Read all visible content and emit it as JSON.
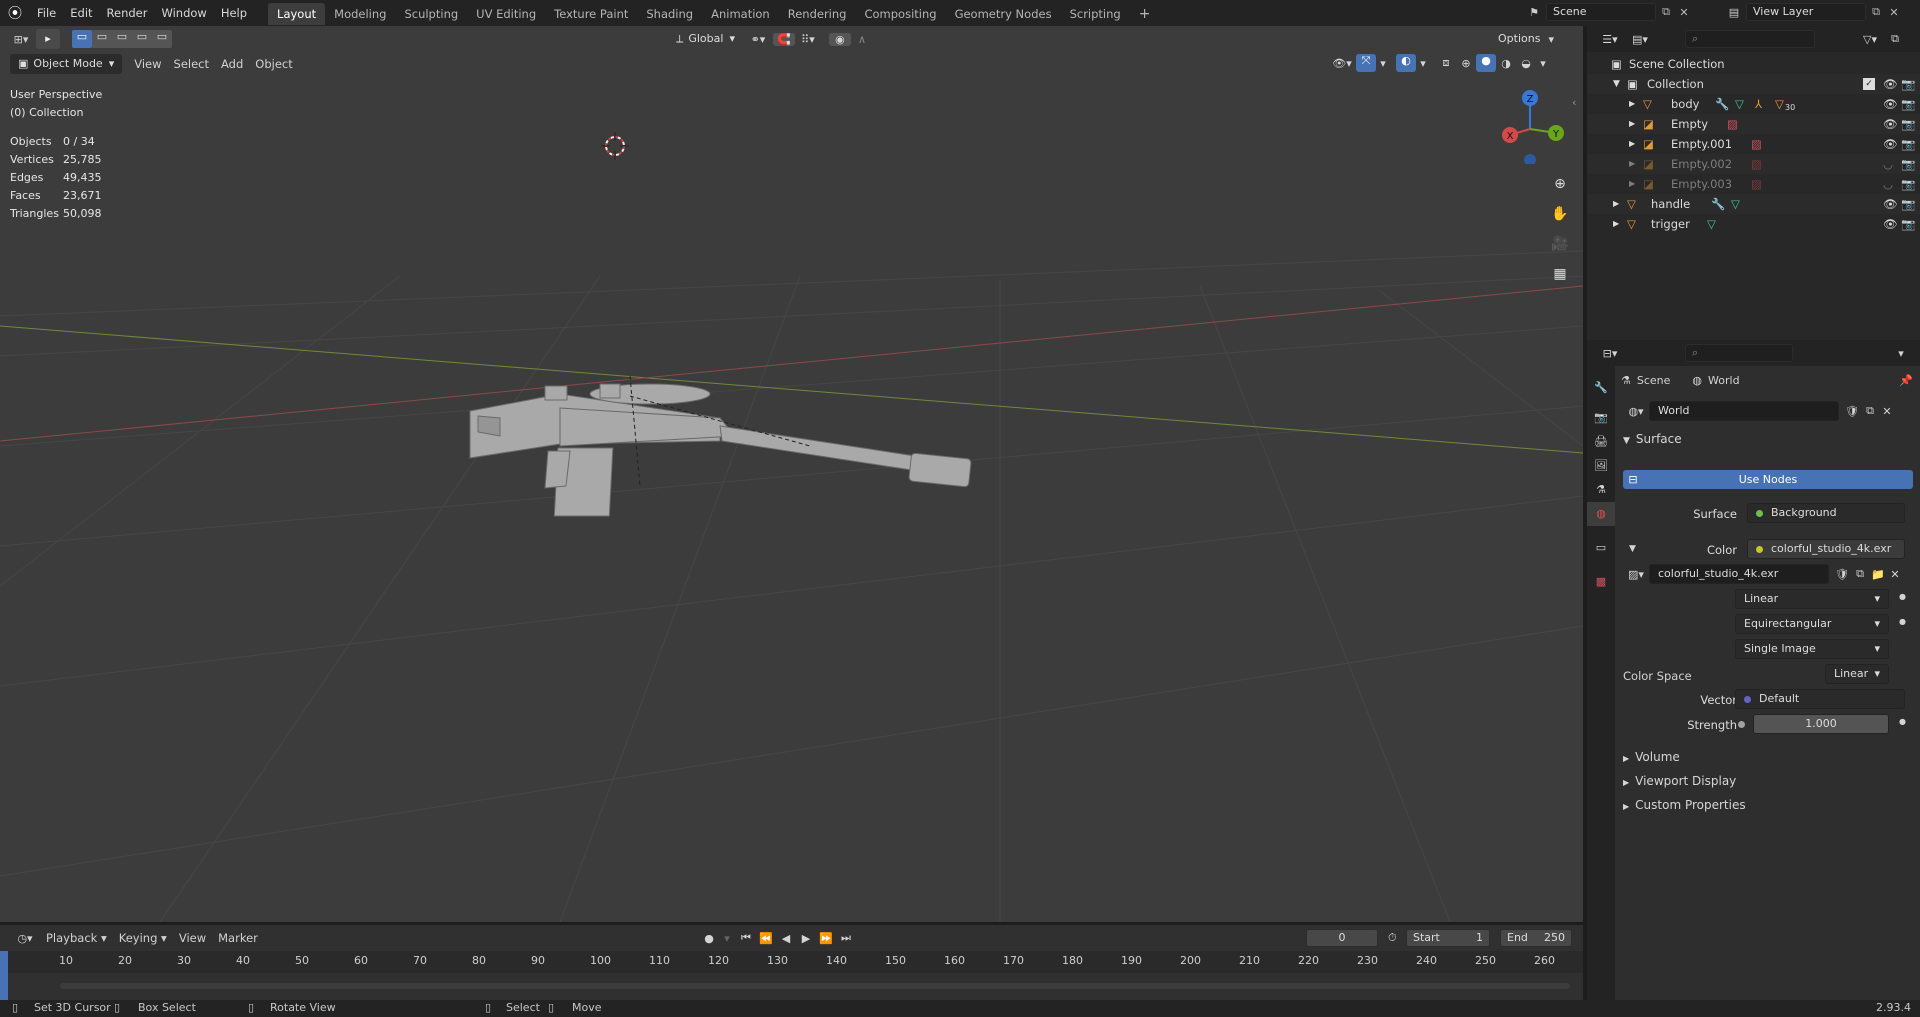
{
  "topbar": {
    "menus": [
      "File",
      "Edit",
      "Render",
      "Window",
      "Help"
    ],
    "workspaces": [
      "Layout",
      "Modeling",
      "Sculpting",
      "UV Editing",
      "Texture Paint",
      "Shading",
      "Animation",
      "Rendering",
      "Compositing",
      "Geometry Nodes",
      "Scripting"
    ],
    "active_workspace": "Layout",
    "add_tab": "+",
    "scene": "Scene",
    "view_layer": "View Layer"
  },
  "viewport_header": {
    "mode": "Object Mode",
    "menus": [
      "View",
      "Select",
      "Add",
      "Object"
    ],
    "transform_orientation": "Global",
    "options": "Options"
  },
  "overlay": {
    "perspective": "User Perspective",
    "collection": "(0) Collection",
    "stats": [
      {
        "label": "Objects",
        "value": "0 / 34"
      },
      {
        "label": "Vertices",
        "value": "25,785"
      },
      {
        "label": "Edges",
        "value": "49,435"
      },
      {
        "label": "Faces",
        "value": "23,671"
      },
      {
        "label": "Triangles",
        "value": "50,098"
      }
    ]
  },
  "gizmo": {
    "z": "Z",
    "x": "X",
    "y": "Y"
  },
  "outliner": {
    "root": "Scene Collection",
    "collection": "Collection",
    "items": [
      {
        "name": "body"
      },
      {
        "name": "Empty"
      },
      {
        "name": "Empty.001"
      },
      {
        "name": "Empty.002"
      },
      {
        "name": "Empty.003"
      }
    ],
    "top_items": [
      {
        "name": "handle"
      },
      {
        "name": "trigger"
      }
    ],
    "modifier_count": "30"
  },
  "properties": {
    "breadcrumb_scene": "Scene",
    "breadcrumb_world": "World",
    "world_name": "World",
    "section_surface": "Surface",
    "use_nodes": "Use Nodes",
    "surface_label": "Surface",
    "surface_value": "Background",
    "color_label": "Color",
    "color_value": "colorful_studio_4k.exr",
    "image_name": "colorful_studio_4k.exr",
    "interpolation": "Linear",
    "projection": "Equirectangular",
    "source": "Single Image",
    "color_space_label": "Color Space",
    "color_space_value": "Linear",
    "vector_label": "Vector",
    "vector_value": "Default",
    "strength_label": "Strength",
    "strength_value": "1.000",
    "sections": [
      "Volume",
      "Viewport Display",
      "Custom Properties"
    ]
  },
  "timeline": {
    "menus": [
      "Playback",
      "Keying",
      "View",
      "Marker"
    ],
    "current_frame": "0",
    "start_label": "Start",
    "start_value": "1",
    "end_label": "End",
    "end_value": "250",
    "ticks": [
      "0",
      "10",
      "20",
      "30",
      "40",
      "50",
      "60",
      "70",
      "80",
      "90",
      "100",
      "110",
      "120",
      "130",
      "140",
      "150",
      "160",
      "170",
      "180",
      "190",
      "200",
      "210",
      "220",
      "230",
      "240",
      "250",
      "260"
    ]
  },
  "statusbar": {
    "items": [
      "Set 3D Cursor",
      "Box Select",
      "Rotate View",
      "Select",
      "Move"
    ],
    "version": "2.93.4"
  }
}
